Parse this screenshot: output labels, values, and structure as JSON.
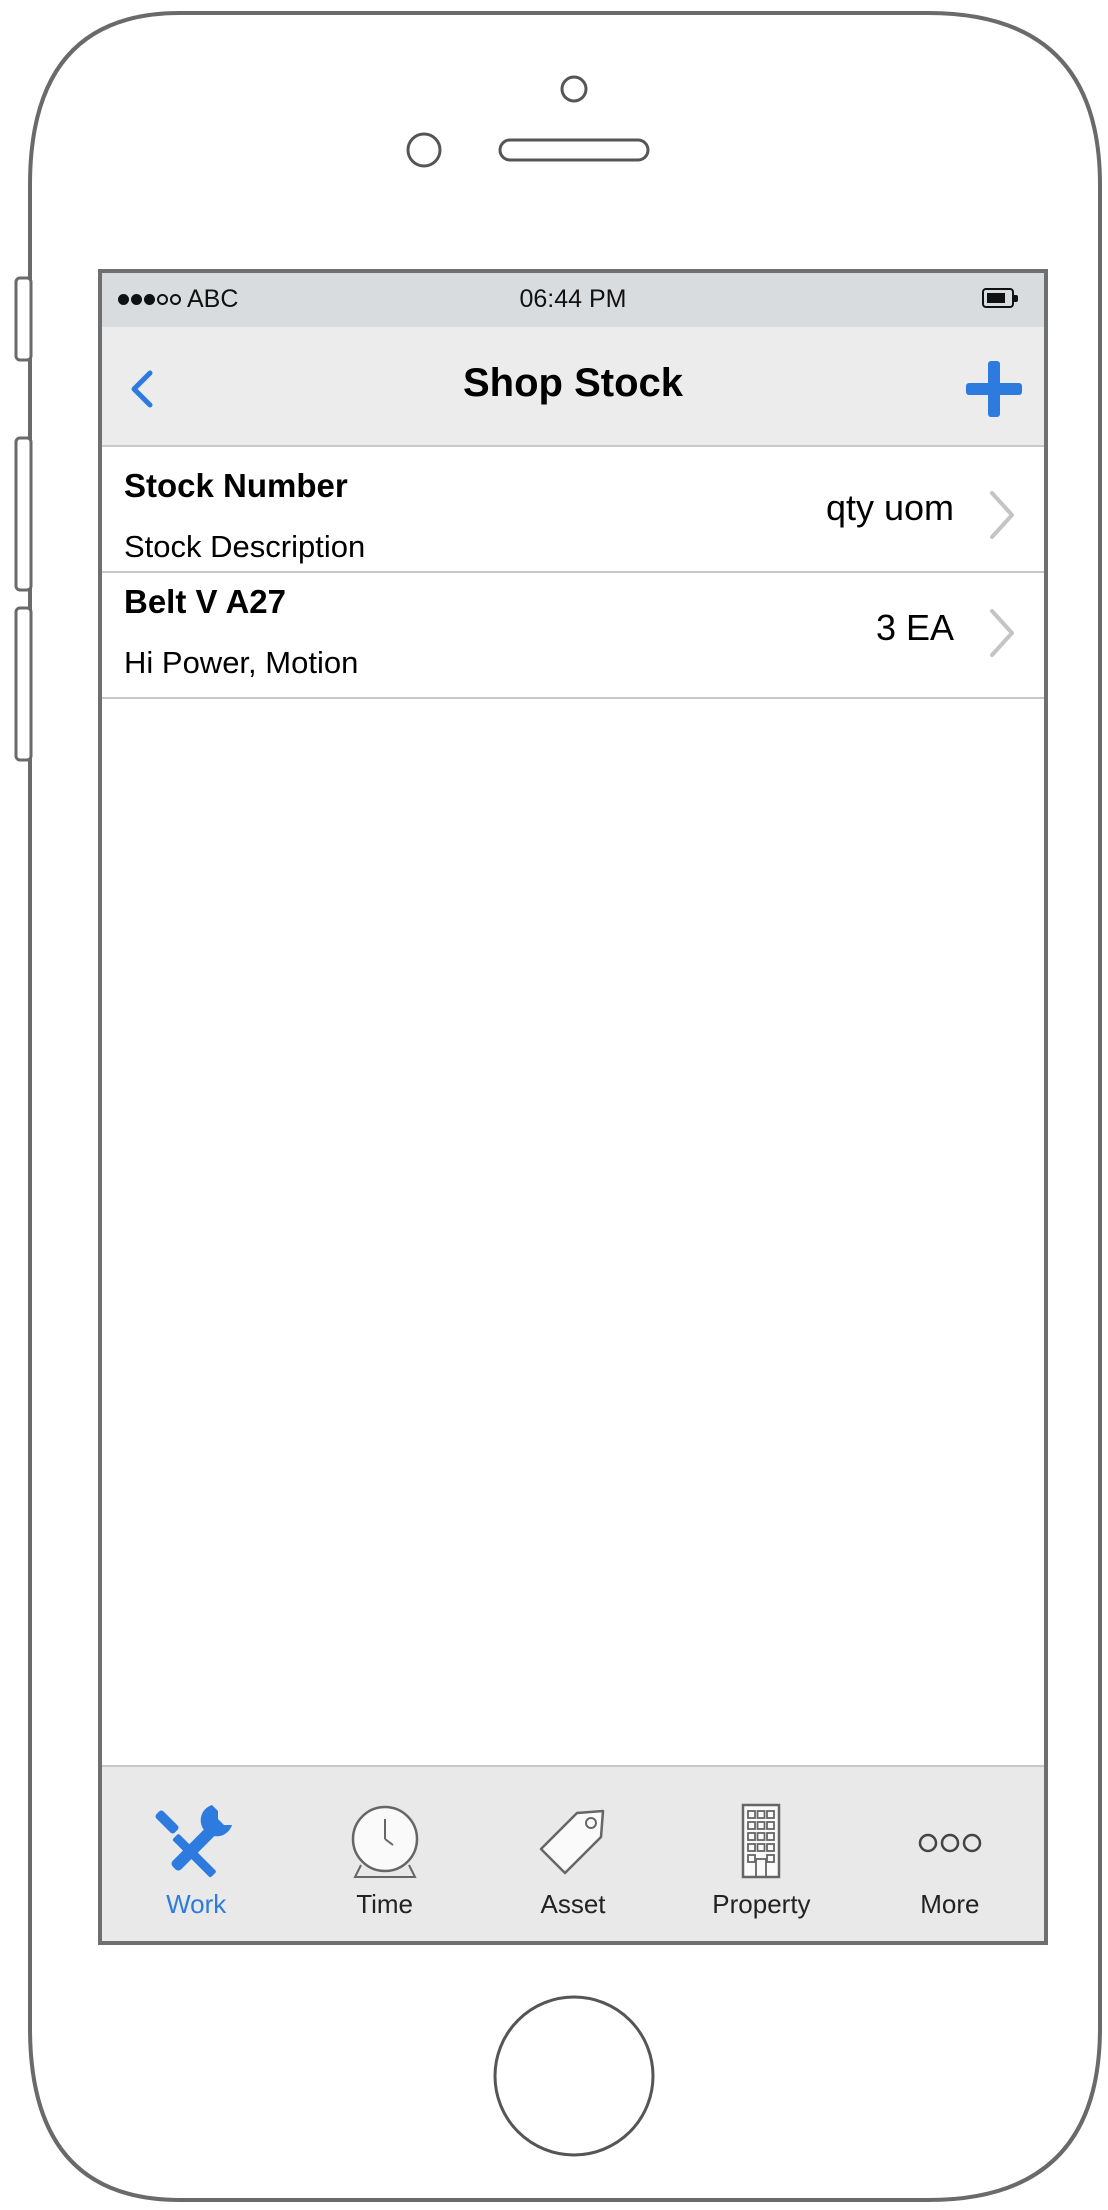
{
  "status_bar": {
    "carrier": "ABC",
    "time": "06:44 PM"
  },
  "nav": {
    "title": "Shop Stock"
  },
  "list": {
    "header": {
      "title": "Stock Number",
      "subtitle": "Stock Description",
      "value": "qty uom"
    },
    "items": [
      {
        "title": "Belt V A27",
        "subtitle": "Hi Power, Motion",
        "value": "3 EA"
      }
    ]
  },
  "tabs": [
    {
      "label": "Work",
      "icon": "wrench-screwdriver-icon",
      "active": true
    },
    {
      "label": "Time",
      "icon": "clock-icon",
      "active": false
    },
    {
      "label": "Asset",
      "icon": "tag-icon",
      "active": false
    },
    {
      "label": "Property",
      "icon": "building-icon",
      "active": false
    },
    {
      "label": "More",
      "icon": "more-dots-icon",
      "active": false
    }
  ],
  "colors": {
    "accent": "#2e7be0",
    "status_bar_bg": "#d9dcde",
    "nav_bg": "#ececec",
    "tab_bar_bg": "#e9e9e9",
    "frame": "#6f6f6f"
  }
}
